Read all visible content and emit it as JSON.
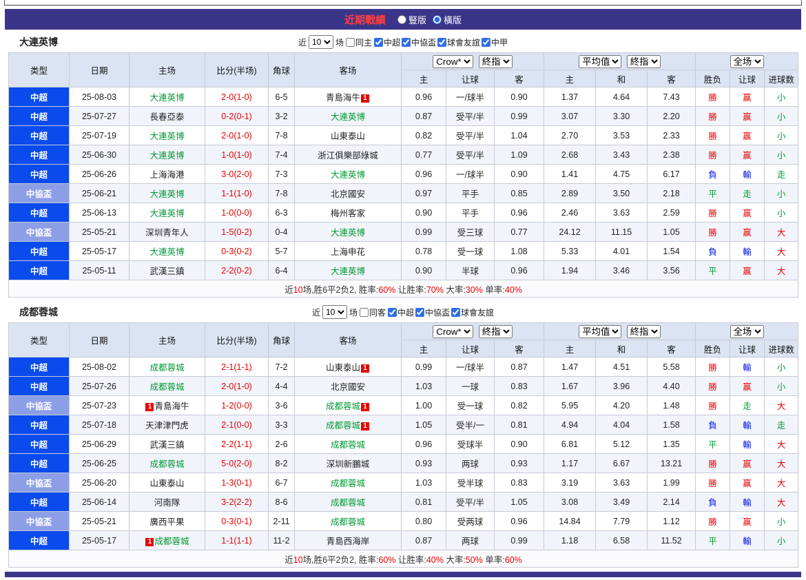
{
  "title_bar": {
    "title": "近期戰績",
    "vertical_label": "豎版",
    "horizontal_label": "橫版"
  },
  "colors": {
    "bar_purple": "#3b3589",
    "league_blue": "#0a4bee",
    "cup_blue": "#8c9fe6",
    "win_red": "#e80000",
    "loss_blue": "#0011ee",
    "draw_green": "#009933",
    "header_bg": "#dce4f3"
  },
  "table_header": {
    "cols": [
      "类型",
      "日期",
      "主场",
      "比分(半场)",
      "角球",
      "客场"
    ],
    "sub": [
      "主",
      "让球",
      "客",
      "主",
      "和",
      "客",
      "胜负",
      "让球",
      "进球数"
    ],
    "odds_company": "Crow*",
    "odds_period": "終指",
    "avg_label": "平均值",
    "avg_period": "終指",
    "scope": "全场"
  },
  "sections": [
    {
      "team": "大連英博",
      "filter": {
        "near": "近",
        "count": "10",
        "games": "场",
        "same": "同主",
        "leagues": [
          "中超",
          "中協盃",
          "球會友誼",
          "中甲"
        ]
      },
      "rows": [
        {
          "type": "中超",
          "date": "25-08-03",
          "home": "大連英博",
          "home_green": true,
          "home_badge": "",
          "score": "2-0(1-0)",
          "corner": "6-5",
          "away": "青島海牛",
          "away_green": false,
          "away_badge": "after",
          "odds": [
            "0.96",
            "一/球半",
            "0.90"
          ],
          "avg": [
            "1.37",
            "4.64",
            "7.43"
          ],
          "results": [
            [
              "勝",
              "r"
            ],
            [
              "赢",
              "r"
            ],
            [
              "小",
              "g"
            ]
          ]
        },
        {
          "type": "中超",
          "date": "25-07-27",
          "home": "長春亞泰",
          "home_green": false,
          "home_badge": "",
          "score": "0-2(0-1)",
          "corner": "3-2",
          "away": "大連英博",
          "away_green": true,
          "away_badge": "",
          "odds": [
            "0.87",
            "受平/半",
            "0.99"
          ],
          "avg": [
            "3.07",
            "3.30",
            "2.20"
          ],
          "results": [
            [
              "勝",
              "r"
            ],
            [
              "赢",
              "r"
            ],
            [
              "小",
              "g"
            ]
          ]
        },
        {
          "type": "中超",
          "date": "25-07-19",
          "home": "大連英博",
          "home_green": true,
          "home_badge": "",
          "score": "2-0(1-0)",
          "corner": "7-8",
          "away": "山東泰山",
          "away_green": false,
          "away_badge": "",
          "odds": [
            "0.82",
            "受平/半",
            "1.04"
          ],
          "avg": [
            "2.70",
            "3.53",
            "2.33"
          ],
          "results": [
            [
              "勝",
              "r"
            ],
            [
              "赢",
              "r"
            ],
            [
              "小",
              "g"
            ]
          ]
        },
        {
          "type": "中超",
          "date": "25-06-30",
          "home": "大連英博",
          "home_green": true,
          "home_badge": "",
          "score": "1-0(1-0)",
          "corner": "7-4",
          "away": "浙江俱樂部綠城",
          "away_green": false,
          "away_badge": "",
          "odds": [
            "0.77",
            "受平/半",
            "1.09"
          ],
          "avg": [
            "2.68",
            "3.43",
            "2.38"
          ],
          "results": [
            [
              "勝",
              "r"
            ],
            [
              "赢",
              "r"
            ],
            [
              "小",
              "g"
            ]
          ]
        },
        {
          "type": "中超",
          "date": "25-06-26",
          "home": "上海海港",
          "home_green": false,
          "home_badge": "",
          "score": "3-0(2-0)",
          "corner": "7-3",
          "away": "大連英博",
          "away_green": true,
          "away_badge": "",
          "odds": [
            "0.96",
            "一/球半",
            "0.90"
          ],
          "avg": [
            "1.41",
            "4.75",
            "6.17"
          ],
          "results": [
            [
              "負",
              "b"
            ],
            [
              "輸",
              "b"
            ],
            [
              "走",
              "g"
            ]
          ]
        },
        {
          "type": "中協盃",
          "date": "25-06-21",
          "home": "大連英博",
          "home_green": true,
          "home_badge": "",
          "score": "1-1(1-0)",
          "corner": "7-8",
          "away": "北京國安",
          "away_green": false,
          "away_badge": "",
          "odds": [
            "0.97",
            "平手",
            "0.85"
          ],
          "avg": [
            "2.89",
            "3.50",
            "2.18"
          ],
          "results": [
            [
              "平",
              "g"
            ],
            [
              "走",
              "g"
            ],
            [
              "小",
              "g"
            ]
          ]
        },
        {
          "type": "中超",
          "date": "25-06-13",
          "home": "大連英博",
          "home_green": true,
          "home_badge": "",
          "score": "1-0(0-0)",
          "corner": "6-3",
          "away": "梅州客家",
          "away_green": false,
          "away_badge": "",
          "odds": [
            "0.90",
            "平手",
            "0.96"
          ],
          "avg": [
            "2.46",
            "3.63",
            "2.59"
          ],
          "results": [
            [
              "勝",
              "r"
            ],
            [
              "赢",
              "r"
            ],
            [
              "小",
              "g"
            ]
          ]
        },
        {
          "type": "中協盃",
          "date": "25-05-21",
          "home": "深圳青年人",
          "home_green": false,
          "home_badge": "",
          "score": "1-5(0-2)",
          "corner": "0-4",
          "away": "大連英博",
          "away_green": true,
          "away_badge": "",
          "odds": [
            "0.99",
            "受三球",
            "0.77"
          ],
          "avg": [
            "24.12",
            "11.15",
            "1.05"
          ],
          "results": [
            [
              "勝",
              "r"
            ],
            [
              "赢",
              "r"
            ],
            [
              "大",
              "r"
            ]
          ]
        },
        {
          "type": "中超",
          "date": "25-05-17",
          "home": "大連英博",
          "home_green": true,
          "home_badge": "",
          "score": "0-3(0-2)",
          "corner": "5-7",
          "away": "上海申花",
          "away_green": false,
          "away_badge": "",
          "odds": [
            "0.78",
            "受一球",
            "1.08"
          ],
          "avg": [
            "5.33",
            "4.01",
            "1.54"
          ],
          "results": [
            [
              "負",
              "b"
            ],
            [
              "輸",
              "b"
            ],
            [
              "大",
              "r"
            ]
          ]
        },
        {
          "type": "中超",
          "date": "25-05-11",
          "home": "武漢三鎮",
          "home_green": false,
          "home_badge": "",
          "score": "2-2(0-2)",
          "corner": "6-4",
          "away": "大連英博",
          "away_green": true,
          "away_badge": "",
          "odds": [
            "0.90",
            "半球",
            "0.96"
          ],
          "avg": [
            "1.94",
            "3.46",
            "3.56"
          ],
          "results": [
            [
              "平",
              "g"
            ],
            [
              "赢",
              "r"
            ],
            [
              "大",
              "r"
            ]
          ]
        }
      ],
      "summary": [
        [
          "近",
          "k"
        ],
        [
          "10",
          "r"
        ],
        [
          "场,胜6平2负2, 胜率:",
          "k"
        ],
        [
          "60%",
          "r"
        ],
        [
          " 让胜率:",
          "k"
        ],
        [
          "70%",
          "r"
        ],
        [
          " 大率:",
          "k"
        ],
        [
          "30%",
          "r"
        ],
        [
          " 单率:",
          "k"
        ],
        [
          "40%",
          "r"
        ]
      ]
    },
    {
      "team": "成都蓉城",
      "filter": {
        "near": "近",
        "count": "10",
        "games": "场",
        "same": "同客",
        "leagues": [
          "中超",
          "中協盃",
          "球會友誼"
        ]
      },
      "rows": [
        {
          "type": "中超",
          "date": "25-08-02",
          "home": "成都蓉城",
          "home_green": true,
          "home_badge": "",
          "score": "2-1(1-1)",
          "corner": "7-2",
          "away": "山東泰山",
          "away_green": false,
          "away_badge": "after",
          "odds": [
            "0.99",
            "一/球半",
            "0.87"
          ],
          "avg": [
            "1.47",
            "4.51",
            "5.58"
          ],
          "results": [
            [
              "勝",
              "r"
            ],
            [
              "輸",
              "b"
            ],
            [
              "小",
              "g"
            ]
          ]
        },
        {
          "type": "中超",
          "date": "25-07-26",
          "home": "成都蓉城",
          "home_green": true,
          "home_badge": "",
          "score": "2-0(1-0)",
          "corner": "4-4",
          "away": "北京國安",
          "away_green": false,
          "away_badge": "",
          "odds": [
            "1.03",
            "一球",
            "0.83"
          ],
          "avg": [
            "1.67",
            "3.96",
            "4.40"
          ],
          "results": [
            [
              "勝",
              "r"
            ],
            [
              "赢",
              "r"
            ],
            [
              "小",
              "g"
            ]
          ]
        },
        {
          "type": "中協盃",
          "date": "25-07-23",
          "home": "青島海牛",
          "home_green": false,
          "home_badge": "before",
          "score": "1-2(0-0)",
          "corner": "3-6",
          "away": "成都蓉城",
          "away_green": true,
          "away_badge": "after",
          "odds": [
            "1.00",
            "受一球",
            "0.82"
          ],
          "avg": [
            "5.95",
            "4.20",
            "1.48"
          ],
          "results": [
            [
              "勝",
              "r"
            ],
            [
              "走",
              "g"
            ],
            [
              "大",
              "r"
            ]
          ]
        },
        {
          "type": "中超",
          "date": "25-07-18",
          "home": "天津津門虎",
          "home_green": false,
          "home_badge": "",
          "score": "2-1(0-0)",
          "corner": "3-3",
          "away": "成都蓉城",
          "away_green": true,
          "away_badge": "after",
          "odds": [
            "1.05",
            "受半/一",
            "0.81"
          ],
          "avg": [
            "4.94",
            "4.04",
            "1.58"
          ],
          "results": [
            [
              "負",
              "b"
            ],
            [
              "輸",
              "b"
            ],
            [
              "走",
              "g"
            ]
          ]
        },
        {
          "type": "中超",
          "date": "25-06-29",
          "home": "武漢三鎮",
          "home_green": false,
          "home_badge": "",
          "score": "2-2(1-1)",
          "corner": "2-6",
          "away": "成都蓉城",
          "away_green": true,
          "away_badge": "",
          "odds": [
            "0.96",
            "受球半",
            "0.90"
          ],
          "avg": [
            "6.81",
            "5.12",
            "1.35"
          ],
          "results": [
            [
              "平",
              "g"
            ],
            [
              "輸",
              "b"
            ],
            [
              "大",
              "r"
            ]
          ]
        },
        {
          "type": "中超",
          "date": "25-06-25",
          "home": "成都蓉城",
          "home_green": true,
          "home_badge": "",
          "score": "5-0(2-0)",
          "corner": "8-2",
          "away": "深圳新鵬城",
          "away_green": false,
          "away_badge": "",
          "odds": [
            "0.93",
            "两球",
            "0.93"
          ],
          "avg": [
            "1.17",
            "6.67",
            "13.21"
          ],
          "results": [
            [
              "勝",
              "r"
            ],
            [
              "赢",
              "r"
            ],
            [
              "大",
              "r"
            ]
          ]
        },
        {
          "type": "中協盃",
          "date": "25-06-20",
          "home": "山東泰山",
          "home_green": false,
          "home_badge": "",
          "score": "1-3(0-1)",
          "corner": "6-7",
          "away": "成都蓉城",
          "away_green": true,
          "away_badge": "",
          "odds": [
            "1.03",
            "受半球",
            "0.83"
          ],
          "avg": [
            "3.19",
            "3.63",
            "1.99"
          ],
          "results": [
            [
              "勝",
              "r"
            ],
            [
              "赢",
              "r"
            ],
            [
              "大",
              "r"
            ]
          ]
        },
        {
          "type": "中超",
          "date": "25-06-14",
          "home": "河南隊",
          "home_green": false,
          "home_badge": "",
          "score": "3-2(2-2)",
          "corner": "8-6",
          "away": "成都蓉城",
          "away_green": true,
          "away_badge": "",
          "odds": [
            "0.81",
            "受平/半",
            "1.05"
          ],
          "avg": [
            "3.08",
            "3.49",
            "2.14"
          ],
          "results": [
            [
              "負",
              "b"
            ],
            [
              "輸",
              "b"
            ],
            [
              "大",
              "r"
            ]
          ]
        },
        {
          "type": "中協盃",
          "date": "25-05-21",
          "home": "廣西平果",
          "home_green": false,
          "home_badge": "",
          "score": "0-3(0-1)",
          "corner": "2-11",
          "away": "成都蓉城",
          "away_green": true,
          "away_badge": "",
          "odds": [
            "0.80",
            "受两球",
            "0.96"
          ],
          "avg": [
            "14.84",
            "7.79",
            "1.12"
          ],
          "results": [
            [
              "勝",
              "r"
            ],
            [
              "赢",
              "r"
            ],
            [
              "小",
              "g"
            ]
          ]
        },
        {
          "type": "中超",
          "date": "25-05-17",
          "home": "成都蓉城",
          "home_green": true,
          "home_badge": "before",
          "score": "1-1(1-1)",
          "corner": "11-2",
          "away": "青島西海岸",
          "away_green": false,
          "away_badge": "",
          "odds": [
            "0.87",
            "两球",
            "0.99"
          ],
          "avg": [
            "1.18",
            "6.58",
            "11.52"
          ],
          "results": [
            [
              "平",
              "g"
            ],
            [
              "輸",
              "b"
            ],
            [
              "小",
              "g"
            ]
          ]
        }
      ],
      "summary": [
        [
          "近",
          "k"
        ],
        [
          "10",
          "r"
        ],
        [
          "场,胜6平2负2, 胜率:",
          "k"
        ],
        [
          "60%",
          "r"
        ],
        [
          " 让胜率:",
          "k"
        ],
        [
          "40%",
          "r"
        ],
        [
          " 大率:",
          "k"
        ],
        [
          "50%",
          "r"
        ],
        [
          " 单率:",
          "k"
        ],
        [
          "60%",
          "r"
        ]
      ]
    }
  ]
}
